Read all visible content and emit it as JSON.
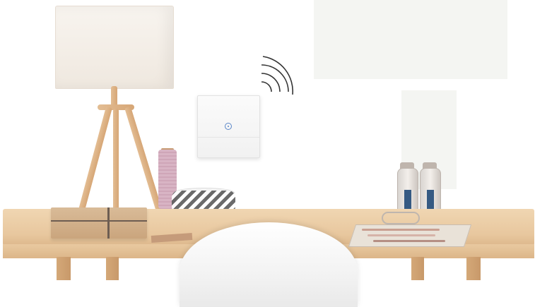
{
  "scene": {
    "description_labels": [],
    "wall_color": "#ffffff",
    "table_color": "#ecd0aa",
    "switch_accent_color": "#5a86c8",
    "icons": [
      "wifi-signal-icon",
      "power-button-icon"
    ]
  }
}
